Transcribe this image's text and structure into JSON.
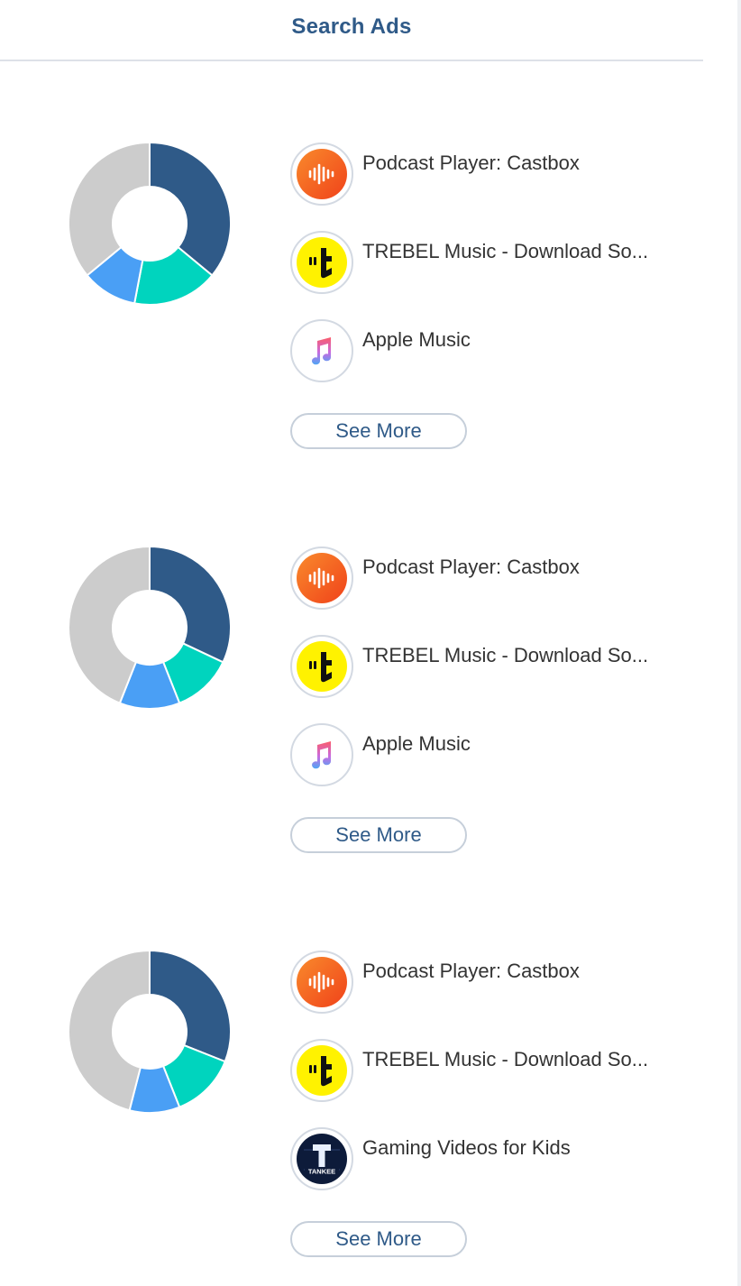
{
  "header": {
    "title": "Search Ads"
  },
  "colors": {
    "segments": [
      "#2f5a88",
      "#00d4be",
      "#4a9ff5",
      "#cccccc"
    ],
    "castbox": "#f45c1f",
    "trebel": "#fff200",
    "tankee": "#0d1b3a"
  },
  "groups": [
    {
      "apps": [
        {
          "name": "Podcast Player: Castbox",
          "icon": "castbox-icon"
        },
        {
          "name": "TREBEL Music - Download So...",
          "icon": "trebel-icon"
        },
        {
          "name": "Apple Music",
          "icon": "apple-music-icon"
        }
      ],
      "see_more": "See More",
      "chart_data": {
        "type": "pie",
        "values": [
          36,
          17,
          11,
          36
        ]
      }
    },
    {
      "apps": [
        {
          "name": "Podcast Player: Castbox",
          "icon": "castbox-icon"
        },
        {
          "name": "TREBEL Music - Download So...",
          "icon": "trebel-icon"
        },
        {
          "name": "Apple Music",
          "icon": "apple-music-icon"
        }
      ],
      "see_more": "See More",
      "chart_data": {
        "type": "pie",
        "values": [
          32,
          12,
          12,
          44
        ]
      }
    },
    {
      "apps": [
        {
          "name": "Podcast Player: Castbox",
          "icon": "castbox-icon"
        },
        {
          "name": "TREBEL Music - Download So...",
          "icon": "trebel-icon"
        },
        {
          "name": "Gaming Videos for Kids",
          "icon": "tankee-icon"
        }
      ],
      "see_more": "See More",
      "chart_data": {
        "type": "pie",
        "values": [
          31,
          13,
          10,
          46
        ]
      }
    }
  ]
}
